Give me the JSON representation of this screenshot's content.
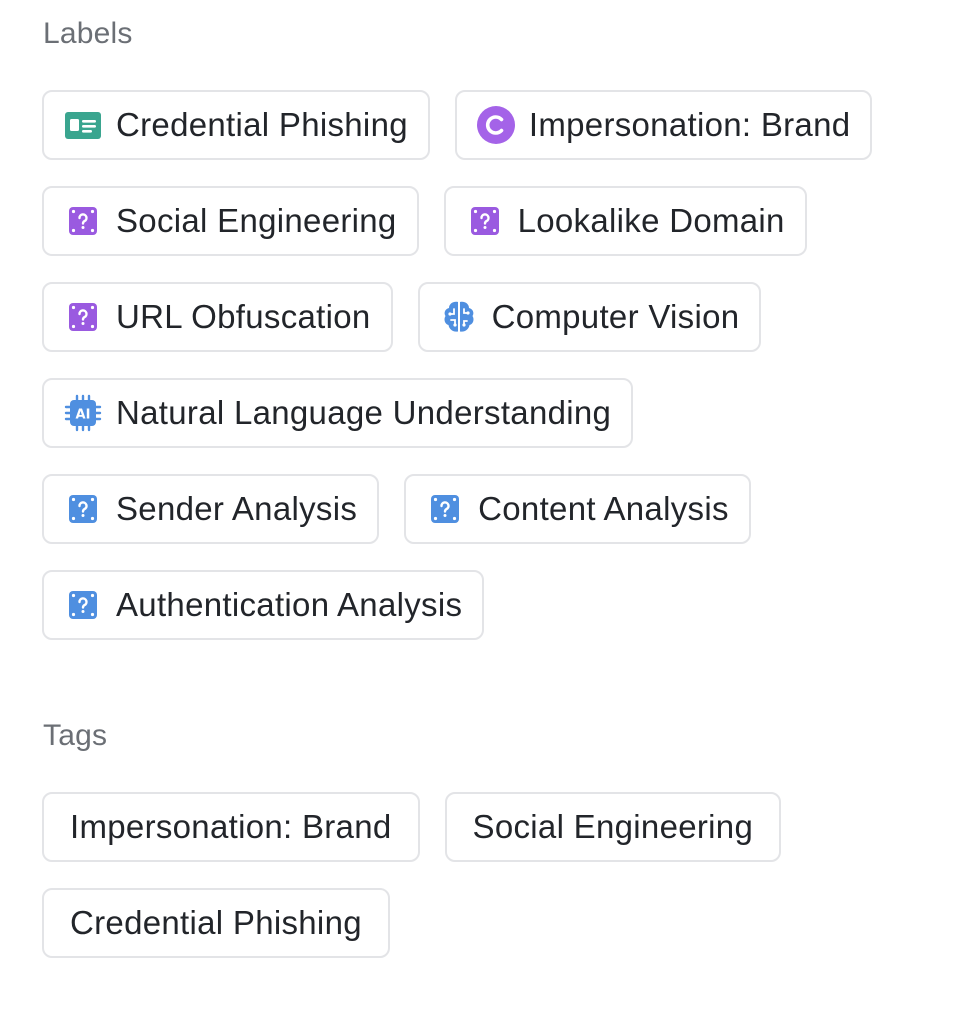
{
  "labels_section": {
    "title": "Labels",
    "items": [
      {
        "label": "Credential Phishing",
        "icon": "id-card-icon",
        "color": "#3aa58f"
      },
      {
        "label": "Impersonation: Brand",
        "icon": "brand-c-icon",
        "color": "#a463e8"
      },
      {
        "label": "Social Engineering",
        "icon": "question-die-icon",
        "color": "#9a5ae0"
      },
      {
        "label": "Lookalike Domain",
        "icon": "question-die-icon",
        "color": "#9a5ae0"
      },
      {
        "label": "URL Obfuscation",
        "icon": "question-die-icon",
        "color": "#9a5ae0"
      },
      {
        "label": "Computer Vision",
        "icon": "brain-icon",
        "color": "#4f8fe0"
      },
      {
        "label": "Natural Language Understanding",
        "icon": "ai-chip-icon",
        "color": "#4f8fe0"
      },
      {
        "label": "Sender Analysis",
        "icon": "question-die-icon",
        "color": "#4f8fe0"
      },
      {
        "label": "Content Analysis",
        "icon": "question-die-icon",
        "color": "#4f8fe0"
      },
      {
        "label": "Authentication Analysis",
        "icon": "question-die-icon",
        "color": "#4f8fe0"
      }
    ]
  },
  "tags_section": {
    "title": "Tags",
    "items": [
      {
        "label": "Impersonation: Brand"
      },
      {
        "label": "Social Engineering"
      },
      {
        "label": "Credential Phishing"
      }
    ]
  }
}
